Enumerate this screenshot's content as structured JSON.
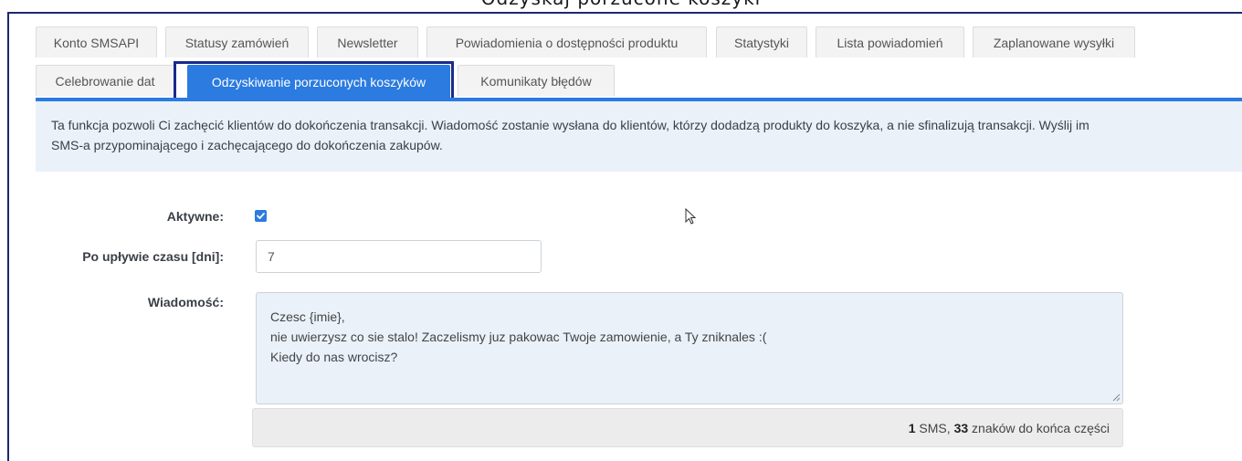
{
  "page_caption": "Odzyskaj porzucone koszyki",
  "tabs": [
    {
      "label": "Konto SMSAPI"
    },
    {
      "label": "Statusy zamówień"
    },
    {
      "label": "Newsletter"
    },
    {
      "label": "Powiadomienia o dostępności produktu"
    },
    {
      "label": "Statystyki"
    },
    {
      "label": "Lista powiadomień"
    },
    {
      "label": "Zaplanowane wysyłki"
    },
    {
      "label": "Celebrowanie dat"
    },
    {
      "label": "Odzyskiwanie porzuconych koszyków",
      "active": true
    },
    {
      "label": "Komunikaty błędów"
    }
  ],
  "info": {
    "line1": "Ta funkcja pozwoli Ci zachęcić klientów do dokończenia transakcji. Wiadomość zostanie wysłana do klientów, którzy dodadzą produkty do koszyka, a nie sfinalizują transakcji. Wyślij im",
    "line2": "SMS-a przypominającego i zachęcającego do dokończenia zakupów."
  },
  "form": {
    "active_label": "Aktywne:",
    "active_checked": true,
    "delay_label": "Po upływie czasu [dni]:",
    "delay_value": "7",
    "message_label": "Wiadomość:",
    "message_lines": [
      "Czesc {imie},",
      "nie uwierzysz co sie stalo! Zaczelismy juz pakowac Twoje zamowienie, a Ty zniknales :(",
      "Kiedy do nas wrocisz?"
    ]
  },
  "counter": {
    "sms_count": "1",
    "sms_text": " SMS, ",
    "chars_count": "33",
    "chars_text": " znaków do końca części"
  },
  "colors": {
    "accent": "#2b7be0",
    "highlight_border": "#1b2a8b",
    "info_bg": "#eaf1f9"
  }
}
